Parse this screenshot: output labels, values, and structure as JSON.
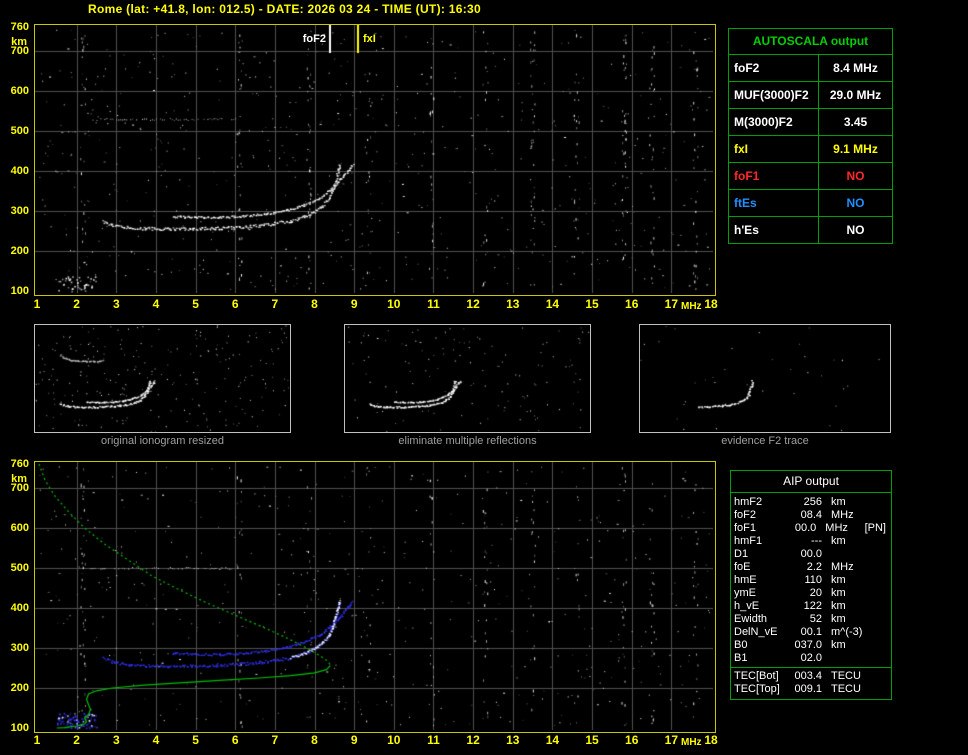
{
  "title": "Rome (lat: +41.8, lon: 012.5) - DATE: 2026 03 24 - TIME (UT): 16:30",
  "colors": {
    "background": "#000000",
    "title": "#ffff00",
    "axis": "#ffff00",
    "plot_border": "#c8c800",
    "grid": "#505050",
    "table_border": "#00a000",
    "autoscala_header": "#00d000",
    "profile_green": "#00bb00",
    "trace_blue": "#3333ff",
    "thumb_border": "#c0c0c0",
    "caption": "#9f9f9f",
    "value_colors": {
      "white": "#ffffff",
      "yellow": "#ffff00",
      "red": "#ff2828",
      "blue": "#2090ff"
    }
  },
  "autoscala_table": {
    "header": "AUTOSCALA output",
    "rows": [
      {
        "label": "foF2",
        "value": "8.4 MHz",
        "color": "white"
      },
      {
        "label": "MUF(3000)F2",
        "value": "29.0 MHz",
        "color": "white"
      },
      {
        "label": "M(3000)F2",
        "value": "3.45",
        "color": "white"
      },
      {
        "label": "fxI",
        "value": "9.1 MHz",
        "color": "yellow"
      },
      {
        "label": "foF1",
        "value": "NO",
        "color": "red"
      },
      {
        "label": "ftEs",
        "value": "NO",
        "color": "blue"
      },
      {
        "label": "h'Es",
        "value": "NO",
        "color": "white"
      }
    ]
  },
  "aip_table": {
    "header": "AIP output",
    "rows": [
      {
        "label": "hmF2",
        "value": "256",
        "unit": "km",
        "note": ""
      },
      {
        "label": "foF2",
        "value": "08.4",
        "unit": "MHz",
        "note": ""
      },
      {
        "label": "foF1",
        "value": "00.0",
        "unit": "MHz",
        "note": "[PN]"
      },
      {
        "label": "hmF1",
        "value": "---",
        "unit": "km",
        "note": ""
      },
      {
        "label": "D1",
        "value": "00.0",
        "unit": "",
        "note": ""
      },
      {
        "label": "foE",
        "value": "2.2",
        "unit": "MHz",
        "note": ""
      },
      {
        "label": "hmE",
        "value": "110",
        "unit": "km",
        "note": ""
      },
      {
        "label": "ymE",
        "value": "20",
        "unit": "km",
        "note": ""
      },
      {
        "label": "h_vE",
        "value": "122",
        "unit": "km",
        "note": ""
      },
      {
        "label": "Ewidth",
        "value": "52",
        "unit": "km",
        "note": ""
      },
      {
        "label": "DelN_vE",
        "value": "00.1",
        "unit": "m^(-3)",
        "note": ""
      },
      {
        "label": "B0",
        "value": "037.0",
        "unit": "km",
        "note": ""
      },
      {
        "label": "B1",
        "value": "02.0",
        "unit": "",
        "note": ""
      }
    ],
    "tec_rows": [
      {
        "label": "TEC[Bot]",
        "value": "003.4",
        "unit": "TECU",
        "note": ""
      },
      {
        "label": "TEC[Top]",
        "value": "009.1",
        "unit": "TECU",
        "note": ""
      }
    ]
  },
  "thumbnails": [
    {
      "caption": "original ionogram resized",
      "mode": "full"
    },
    {
      "caption": "eliminate multiple reflections",
      "mode": "clean"
    },
    {
      "caption": "evidence F2 trace",
      "mode": "f2only"
    }
  ],
  "chart_data": {
    "type": "scatter",
    "description": "ionogram echoes: virtual height (km) vs sounding frequency (MHz); bottom panel adds restored N(h) profile",
    "x_axis": {
      "label": "MHz",
      "min": 1,
      "max": 18,
      "ticks": [
        1,
        2,
        3,
        4,
        5,
        6,
        7,
        8,
        9,
        10,
        11,
        12,
        13,
        14,
        15,
        16,
        17,
        18
      ]
    },
    "y_axis": {
      "label": "km",
      "min": 100,
      "max": 760,
      "ticks": [
        760,
        700,
        600,
        500,
        400,
        300,
        200,
        100
      ]
    },
    "markers": {
      "foF2_label": "foF2",
      "foF2_MHz": 8.4,
      "fxI_label": "fxI",
      "fxI_MHz": 9.1
    },
    "f2_trace_o": [
      [
        2.65,
        275
      ],
      [
        2.9,
        266
      ],
      [
        3.3,
        260
      ],
      [
        3.8,
        257
      ],
      [
        4.3,
        256
      ],
      [
        4.9,
        256
      ],
      [
        5.5,
        258
      ],
      [
        6.1,
        261
      ],
      [
        6.6,
        265
      ],
      [
        7.0,
        270
      ],
      [
        7.4,
        277
      ],
      [
        7.75,
        288
      ],
      [
        8.0,
        300
      ],
      [
        8.2,
        315
      ],
      [
        8.35,
        333
      ],
      [
        8.45,
        355
      ],
      [
        8.52,
        378
      ],
      [
        8.58,
        400
      ],
      [
        8.62,
        418
      ]
    ],
    "f2_trace_x": [
      [
        4.4,
        288
      ],
      [
        5.0,
        285
      ],
      [
        5.6,
        285
      ],
      [
        6.2,
        288
      ],
      [
        6.8,
        294
      ],
      [
        7.3,
        303
      ],
      [
        7.7,
        315
      ],
      [
        8.1,
        332
      ],
      [
        8.4,
        355
      ],
      [
        8.65,
        380
      ],
      [
        8.85,
        405
      ],
      [
        8.95,
        418
      ]
    ],
    "profile_topside": [
      [
        1.05,
        760
      ],
      [
        1.2,
        720
      ],
      [
        1.45,
        680
      ],
      [
        1.8,
        640
      ],
      [
        2.2,
        600
      ],
      [
        2.7,
        560
      ],
      [
        3.3,
        520
      ],
      [
        3.9,
        480
      ],
      [
        4.6,
        445
      ],
      [
        5.3,
        412
      ],
      [
        6.0,
        382
      ],
      [
        6.7,
        352
      ],
      [
        7.3,
        325
      ],
      [
        7.8,
        300
      ],
      [
        8.15,
        280
      ],
      [
        8.35,
        266
      ],
      [
        8.4,
        256
      ]
    ],
    "profile_bottomside": [
      [
        8.4,
        256
      ],
      [
        8.3,
        246
      ],
      [
        8.0,
        238
      ],
      [
        7.4,
        231
      ],
      [
        6.6,
        225
      ],
      [
        5.6,
        219
      ],
      [
        4.6,
        213
      ],
      [
        3.7,
        207
      ],
      [
        2.9,
        200
      ],
      [
        2.5,
        193
      ],
      [
        2.3,
        185
      ],
      [
        2.25,
        172
      ],
      [
        2.3,
        158
      ],
      [
        2.35,
        146
      ],
      [
        2.3,
        134
      ],
      [
        2.2,
        124
      ],
      [
        2.25,
        116
      ],
      [
        2.2,
        110
      ],
      [
        2.0,
        105
      ],
      [
        1.7,
        101
      ],
      [
        1.5,
        100
      ]
    ],
    "es_patch": {
      "f_range": [
        1.5,
        2.5
      ],
      "h_range": [
        100,
        138
      ]
    },
    "noise": {
      "seed": 20260324,
      "top_count": 620,
      "bottom_count": 500,
      "stripes_MHz": [
        2.15,
        6.1,
        7.85,
        9.35,
        10.95,
        12.3,
        13.5,
        14.6,
        15.8,
        16.5,
        17.6
      ],
      "top_band": {
        "h_km": 530,
        "f_range": [
          2.4,
          6.0
        ]
      },
      "bottom_band": {
        "h_km": 500,
        "f_range": [
          2.3,
          5.9
        ]
      }
    }
  }
}
